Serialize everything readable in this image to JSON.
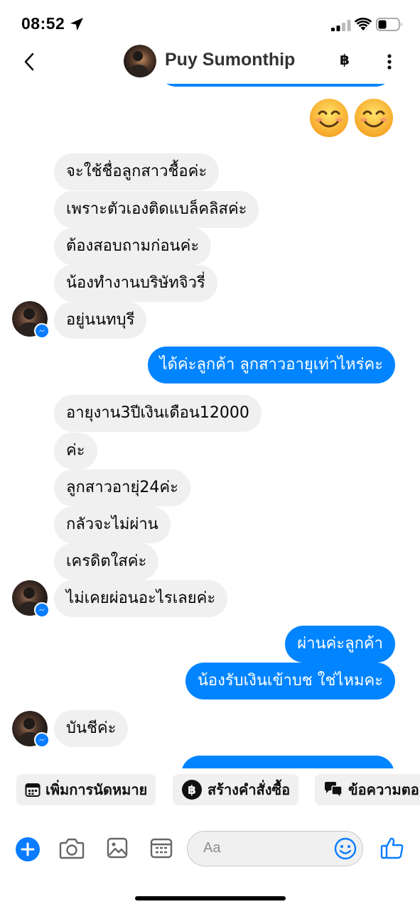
{
  "status_bar": {
    "time": "08:52"
  },
  "header": {
    "contact_name": "Puy Sumonthip",
    "currency_symbol": "฿"
  },
  "messages": [
    {
      "dir": "in",
      "text": "จะใช้ชื่อลูกสาวชื้อค่ะ"
    },
    {
      "dir": "in",
      "text": "เพราะตัวเองติดแบล็คลิสค่ะ"
    },
    {
      "dir": "in",
      "text": "ต้องสอบถามก่อนค่ะ"
    },
    {
      "dir": "in",
      "text": "น้องทำงานบริษัทจิวรี่"
    },
    {
      "dir": "in",
      "text": "อยู่นนทบุรี"
    },
    {
      "dir": "out",
      "text": "ได้ค่ะลูกค้า ลูกสาวอายุเท่าไหร่คะ"
    },
    {
      "dir": "in",
      "text": "อายุงาน3ปีเงินเดือน12000"
    },
    {
      "dir": "in",
      "text": "ค่ะ"
    },
    {
      "dir": "in",
      "text": "ลูกสาวอายุ่24ค่ะ"
    },
    {
      "dir": "in",
      "text": "กลัวจะไม่ผ่าน"
    },
    {
      "dir": "in",
      "text": "เครดิตใสค่ะ"
    },
    {
      "dir": "in",
      "text": "ไม่เคยผ่อนอะไรเลยค่ะ"
    },
    {
      "dir": "out",
      "text": "ผ่านค่ะลูกค้า"
    },
    {
      "dir": "out",
      "text": "น้องรับเงินเข้าบช ใช่ไหมคะ"
    },
    {
      "dir": "in",
      "text": "บันชีค่ะ"
    }
  ],
  "quick_actions": [
    {
      "label": "เพิ่มการนัดหมาย",
      "icon": "calendar-icon"
    },
    {
      "label": "สร้างคำสั่งซื้อ",
      "icon": "baht-icon"
    },
    {
      "label": "ข้อความตอ",
      "icon": "saved-replies-icon"
    }
  ],
  "composer": {
    "placeholder": "Aa"
  },
  "colors": {
    "outgoing": "#0084ff",
    "incoming": "#f0f0f0",
    "accent": "#0a7cff"
  }
}
